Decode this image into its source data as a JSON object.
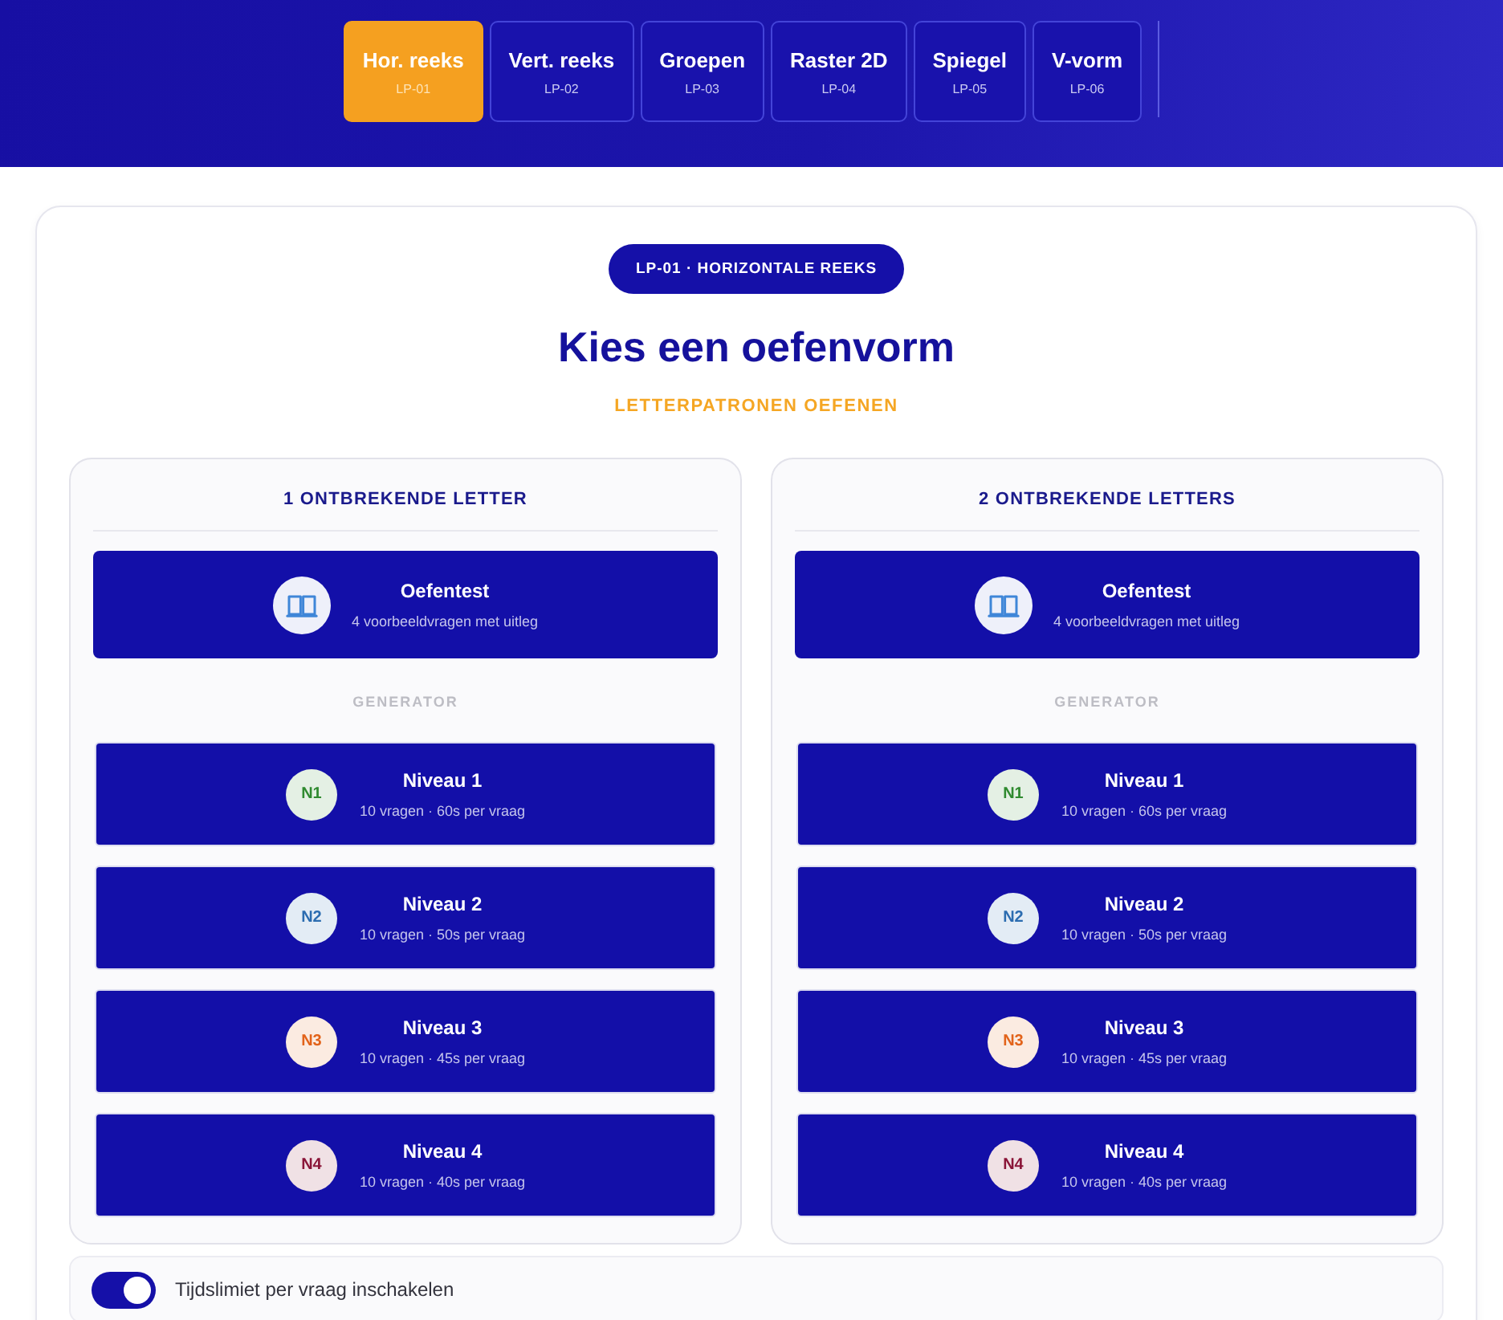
{
  "tabs": [
    {
      "label": "Hor. reeks",
      "code": "LP-01",
      "selected": true
    },
    {
      "label": "Vert. reeks",
      "code": "LP-02",
      "selected": false
    },
    {
      "label": "Groepen",
      "code": "LP-03",
      "selected": false
    },
    {
      "label": "Raster 2D",
      "code": "LP-04",
      "selected": false
    },
    {
      "label": "Spiegel",
      "code": "LP-05",
      "selected": false
    },
    {
      "label": "V-vorm",
      "code": "LP-06",
      "selected": false
    }
  ],
  "badge": "LP-01 · HORIZONTALE REEKS",
  "title": "Kies een oefenvorm",
  "subtitle": "LETTERPATRONEN OEFENEN",
  "columns": [
    {
      "heading": "1 ONTBREKENDE LETTER",
      "practice": {
        "title": "Oefentest",
        "subtitle": "4 voorbeeldvragen met uitleg"
      },
      "section_label": "GENERATOR",
      "levels": [
        {
          "badge": "N1",
          "title": "Niveau 1",
          "subtitle": "10 vragen · 60s per vraag",
          "color": "#2f8a2f"
        },
        {
          "badge": "N2",
          "title": "Niveau 2",
          "subtitle": "10 vragen · 50s per vraag",
          "color": "#2b6cb0"
        },
        {
          "badge": "N3",
          "title": "Niveau 3",
          "subtitle": "10 vragen · 45s per vraag",
          "color": "#e2631a"
        },
        {
          "badge": "N4",
          "title": "Niveau 4",
          "subtitle": "10 vragen · 40s per vraag",
          "color": "#8a1538"
        }
      ]
    },
    {
      "heading": "2 ONTBREKENDE LETTERS",
      "practice": {
        "title": "Oefentest",
        "subtitle": "4 voorbeeldvragen met uitleg"
      },
      "section_label": "GENERATOR",
      "levels": [
        {
          "badge": "N1",
          "title": "Niveau 1",
          "subtitle": "10 vragen · 60s per vraag",
          "color": "#2f8a2f"
        },
        {
          "badge": "N2",
          "title": "Niveau 2",
          "subtitle": "10 vragen · 50s per vraag",
          "color": "#2b6cb0"
        },
        {
          "badge": "N3",
          "title": "Niveau 3",
          "subtitle": "10 vragen · 45s per vraag",
          "color": "#e2631a"
        },
        {
          "badge": "N4",
          "title": "Niveau 4",
          "subtitle": "10 vragen · 40s per vraag",
          "color": "#8a1538"
        }
      ]
    }
  ],
  "time_limit": {
    "label": "Tijdslimiet per vraag inschakelen",
    "on": true
  }
}
